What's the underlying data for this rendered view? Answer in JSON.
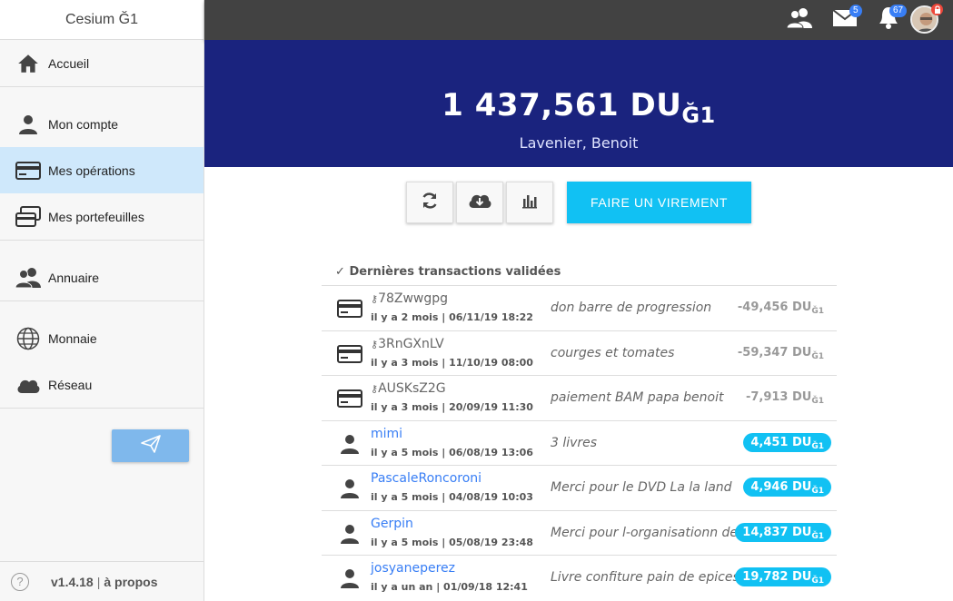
{
  "app": {
    "title": "Cesium Ğ1"
  },
  "sidebar": {
    "items": [
      {
        "label": "Accueil",
        "icon": "home-icon"
      },
      {
        "label": "Mon compte",
        "icon": "person-icon"
      },
      {
        "label": "Mes opérations",
        "icon": "card-icon"
      },
      {
        "label": "Mes portefeuilles",
        "icon": "cards-icon"
      },
      {
        "label": "Annuaire",
        "icon": "people-icon"
      },
      {
        "label": "Monnaie",
        "icon": "world-icon"
      },
      {
        "label": "Réseau",
        "icon": "cloud-icon"
      }
    ],
    "footer": {
      "version": "v1.4.18",
      "separator": "|",
      "about": "à propos"
    }
  },
  "topbar": {
    "messages_count": "5",
    "notifications_count": "67"
  },
  "account": {
    "balance": "1 437,561 DU",
    "unit": "Ğ1",
    "owner": "Lavenier, Benoit"
  },
  "actions": {
    "transfer_label": "FAIRE UN VIREMENT"
  },
  "transactions": {
    "title": "Dernières transactions validées",
    "rows": [
      {
        "type": "key",
        "name": "78Zwwgpg",
        "date": "il y a 2 mois | 06/11/19 18:22",
        "comment": "don barre de progression",
        "amount": "-49,456 DU",
        "unit": "Ğ1",
        "positive": false
      },
      {
        "type": "key",
        "name": "3RnGXnLV",
        "date": "il y a 3 mois | 11/10/19 08:00",
        "comment": "courges et tomates",
        "amount": "-59,347 DU",
        "unit": "Ğ1",
        "positive": false
      },
      {
        "type": "key",
        "name": "AUSKsZ2G",
        "date": "il y a 3 mois | 20/09/19 11:30",
        "comment": "paiement BAM papa benoit",
        "amount": "-7,913 DU",
        "unit": "Ğ1",
        "positive": false
      },
      {
        "type": "user",
        "name": "mimi",
        "date": "il y a 5 mois | 06/08/19 13:06",
        "comment": "3 livres",
        "amount": "4,451 DU",
        "unit": "Ğ1",
        "positive": true
      },
      {
        "type": "user",
        "name": "PascaleRoncoroni",
        "date": "il y a 5 mois | 04/08/19 10:03",
        "comment": "Merci pour le DVD La la land",
        "amount": "4,946 DU",
        "unit": "Ğ1",
        "positive": true
      },
      {
        "type": "user",
        "name": "Gerpin",
        "date": "il y a 5 mois | 05/08/19 23:48",
        "comment": "Merci pour l-organisationn de cette",
        "amount": "14,837 DU",
        "unit": "Ğ1",
        "positive": true
      },
      {
        "type": "user",
        "name": "josyaneperez",
        "date": "il y a un an | 01/09/18 12:41",
        "comment": "Livre confiture pain de epices",
        "amount": "19,782 DU",
        "unit": "Ğ1",
        "positive": true
      }
    ]
  },
  "colors": {
    "banner": "#1a237e",
    "accent": "#11c1f3",
    "topbar": "#424242",
    "active_menu": "#cfe8fb"
  }
}
